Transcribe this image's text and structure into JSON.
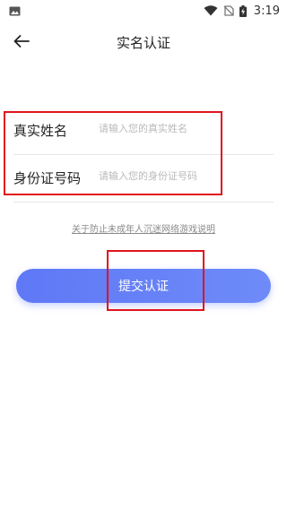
{
  "status_bar": {
    "left_icon": "image-icon",
    "time": "3:19",
    "icons": [
      "wifi-icon",
      "no-sim-icon",
      "battery-charging-icon"
    ]
  },
  "header": {
    "back_icon": "arrow-left-icon",
    "title": "实名认证"
  },
  "form": {
    "name_label": "真实姓名",
    "name_placeholder": "请输入您的真实姓名",
    "id_label": "身份证号码",
    "id_placeholder": "请输入您的身份证号码"
  },
  "notice_link": "关于防止未成年人沉迷网络游戏说明",
  "submit_label": "提交认证",
  "colors": {
    "accent_start": "#5f78f6",
    "accent_end": "#6e8bf8",
    "annotation_red": "#e0141d"
  }
}
